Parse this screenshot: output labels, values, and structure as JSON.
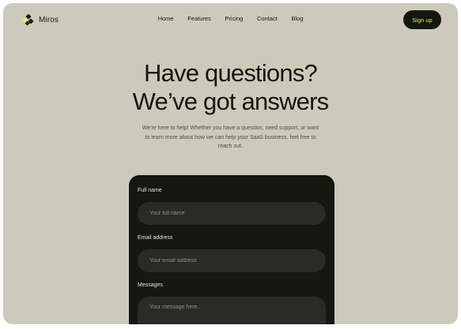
{
  "brand": {
    "name": "Miros",
    "accent_color": "#d7f05a",
    "dark_color": "#14170f",
    "background_color": "#cdcabb",
    "logo_icon": "miros-logo-icon"
  },
  "nav": {
    "links": [
      {
        "label": "Home"
      },
      {
        "label": "Features"
      },
      {
        "label": "Pricing"
      },
      {
        "label": "Contact"
      },
      {
        "label": "Blog"
      }
    ],
    "signup_label": "Sign up"
  },
  "hero": {
    "title_line1": "Have questions?",
    "title_line2": "We’ve got answers",
    "description": "We're here to help! Whether you have a question, need support, or want to learn more about how we can help your SaaS business, feel free to reach out."
  },
  "form": {
    "full_name": {
      "label": "Full name",
      "placeholder": "Your full name",
      "value": ""
    },
    "email": {
      "label": "Email address",
      "placeholder": "Your email address",
      "value": ""
    },
    "message": {
      "label": "Messages",
      "placeholder": "Your message here..",
      "value": ""
    }
  }
}
